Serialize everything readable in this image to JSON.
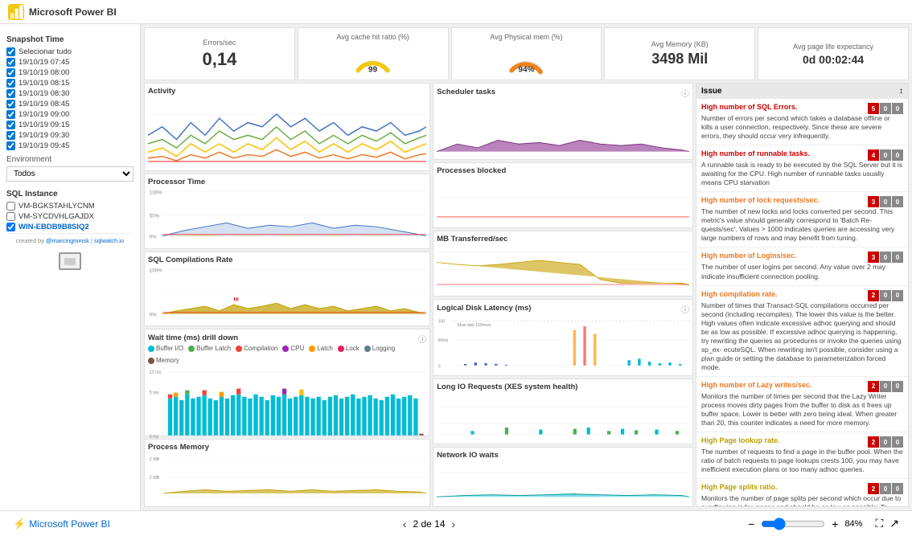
{
  "topbar": {
    "title": "Microsoft Power BI"
  },
  "sidebar": {
    "snapshot_title": "Snapshot Time",
    "select_all": "Selecionar tudo",
    "snapshots": [
      "19/10/19 07:45",
      "19/10/19 08:00",
      "19/10/19 08:15",
      "19/10/19 08:30",
      "19/10/19 08:45",
      "19/10/19 09:00",
      "19/10/19 09:15",
      "19/10/19 09:30",
      "19/10/19 09:45"
    ],
    "environment_label": "Environment",
    "environment_value": "Todos",
    "sql_instance_title": "SQL Instance",
    "instances": [
      {
        "name": "VM-BGKSTAHLYCNM",
        "checked": false
      },
      {
        "name": "VM-SYCDVHLGAJDX",
        "checked": false
      },
      {
        "name": "WIN-EBDB9B8SIQ2",
        "checked": true
      }
    ]
  },
  "kpis": [
    {
      "title": "Errors/sec",
      "value": "0,14",
      "type": "number"
    },
    {
      "title": "Avg cache hit ratio (%)",
      "value": "99",
      "type": "gauge",
      "gauge_color": "#f2c811"
    },
    {
      "title": "Avg Physical mem (%)",
      "value": "94%",
      "type": "gauge",
      "gauge_color": "#f2811a"
    },
    {
      "title": "Avg Memory (KB)",
      "value": "3498 Mil",
      "type": "number"
    },
    {
      "title": "Avg page life expectancy",
      "value": "0d 00:02:44",
      "type": "number"
    }
  ],
  "charts": {
    "activity": {
      "title": "Activity"
    },
    "processor_time": {
      "title": "Processor Time"
    },
    "sql_compilations": {
      "title": "SQL Compilations Rate"
    },
    "wait_time": {
      "title": "Wait time (ms) drill down"
    },
    "process_memory": {
      "title": "Process Memory"
    },
    "scheduler_tasks": {
      "title": "Scheduler tasks"
    },
    "processes_blocked": {
      "title": "Processes blocked"
    },
    "mb_transferred": {
      "title": "MB Transferred/sec"
    },
    "logical_disk": {
      "title": "Logical Disk Latency (ms)"
    },
    "long_io": {
      "title": "Long IO Requests (XES system health)"
    },
    "network_io": {
      "title": "Network IO waits"
    }
  },
  "wait_legend": [
    {
      "label": "Buffer I/O",
      "color": "#00bcd4"
    },
    {
      "label": "Buffer Latch",
      "color": "#4caf50"
    },
    {
      "label": "Compilation",
      "color": "#f44336"
    },
    {
      "label": "CPU",
      "color": "#9c27b0"
    },
    {
      "label": "Latch",
      "color": "#ff9800"
    },
    {
      "label": "Lock",
      "color": "#e91e63"
    },
    {
      "label": "Logging",
      "color": "#607d8b"
    },
    {
      "label": "Memory",
      "color": "#795548"
    }
  ],
  "issues": [
    {
      "title": "High number of SQL Errors.",
      "title_color": "red",
      "desc": "Number of errors per second which takes a database offline or kills a user connection, respectively. Since these are severe errors, they should occur very infrequently.",
      "badges": [
        5,
        0,
        0
      ]
    },
    {
      "title": "High number of runnable tasks.",
      "title_color": "red",
      "desc": "A runnable task is ready to be executed by the SQL Server but it is awaiting for the CPU. High number of runnable tasks usually means CPU starvation",
      "badges": [
        4,
        0,
        0
      ]
    },
    {
      "title": "High number of lock requests/sec.",
      "title_color": "orange",
      "desc": "The number of new locks and locks converted per second. This metric's value should generally correspond to 'Batch Re- quests/sec'. Values > 1000 indicates queries are accessing very large numbers of rows and may benefit from tuning.",
      "badges": [
        3,
        0,
        0
      ]
    },
    {
      "title": "High number of Logins/sec.",
      "title_color": "orange",
      "desc": "The number of user logins per second. Any value over 2 may indicate insufficient connection pooling.",
      "badges": [
        3,
        0,
        0
      ]
    },
    {
      "title": "High compilation rate.",
      "title_color": "orange",
      "desc": "Number of times that Transact-SQL compilations occurred per second (including recompiles). The lower this value is the better. High values often indicate excessive adhoc querying and should be as low as possible. If excessive adhoc querying is happening, try rewriting the queries as procedures or invoke the queries using sp_ex- ecuteSQL. When rewriting isn't possible, consider using a plan guide or setting the database to parameterization forced mode.",
      "badges": [
        2,
        0,
        0
      ]
    },
    {
      "title": "High number of Lazy writes/sec.",
      "title_color": "orange",
      "desc": "Monitors the number of times per second that the Lazy Writer process moves dirty pages from the buffer to disk as it frees up buffer space. Lower is better with zero being ideal. When greater than 20, this counter indicates a need for more memory.",
      "badges": [
        2,
        0,
        0
      ]
    },
    {
      "title": "High Page lookup rate.",
      "title_color": "yellow",
      "desc": "The number of requests to find a page in the buffer pool. When the ratio of batch requests to page lookups crests 100, you may have inefficient execution plans or too many adhoc queries.",
      "badges": [
        2,
        0,
        0
      ]
    },
    {
      "title": "High Page splits ratio.",
      "title_color": "yellow",
      "desc": "Monitors the number of page splits per second which occur due to overflowing index pages and should be as low as possible. To avoid page splits, review table and index design to reduce non-sequential inserts by using filling factor.",
      "badges": [
        2,
        0,
        0
      ]
    }
  ],
  "issue_header": "Issue",
  "bottom": {
    "prev": "‹",
    "next": "›",
    "page_info": "2 de 14",
    "zoom": "84%"
  }
}
